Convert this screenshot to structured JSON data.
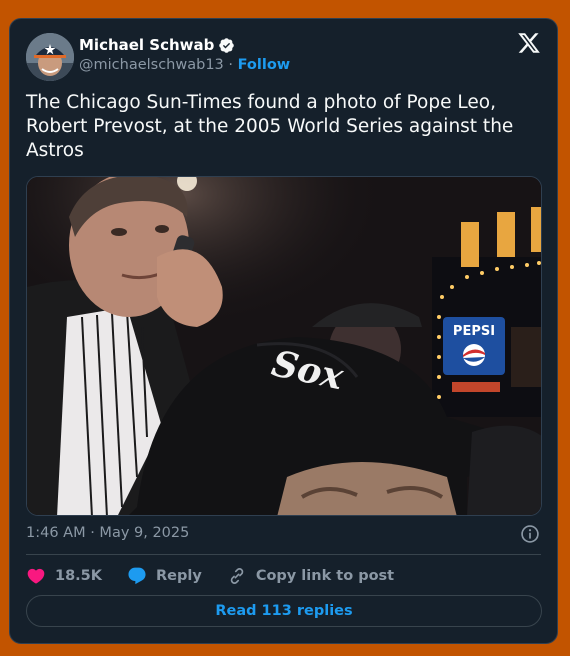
{
  "author": {
    "name": "Michael Schwab",
    "handle": "@michaelschwab13",
    "separator": "·",
    "follow_label": "Follow"
  },
  "tweet": {
    "text": "The Chicago Sun-Times found a photo of Pope Leo, Robert Prevost, at the 2005 World Series against the Astros",
    "timestamp": "1:46 AM · May 9, 2025",
    "photo_sign_text": "PEPSI",
    "photo_cap_text": "Sox"
  },
  "actions": {
    "likes_count": "18.5K",
    "reply_label": "Reply",
    "copy_link_label": "Copy link to post"
  },
  "read_replies_label": "Read 113 replies",
  "colors": {
    "background": "#c25400",
    "card": "#15202b",
    "accent": "#1d9bf0",
    "like": "#f91880",
    "text_secondary": "#8b98a5"
  },
  "icons": [
    "verified-badge-icon",
    "x-logo-icon",
    "info-icon",
    "heart-icon",
    "reply-bubble-icon",
    "link-icon"
  ]
}
